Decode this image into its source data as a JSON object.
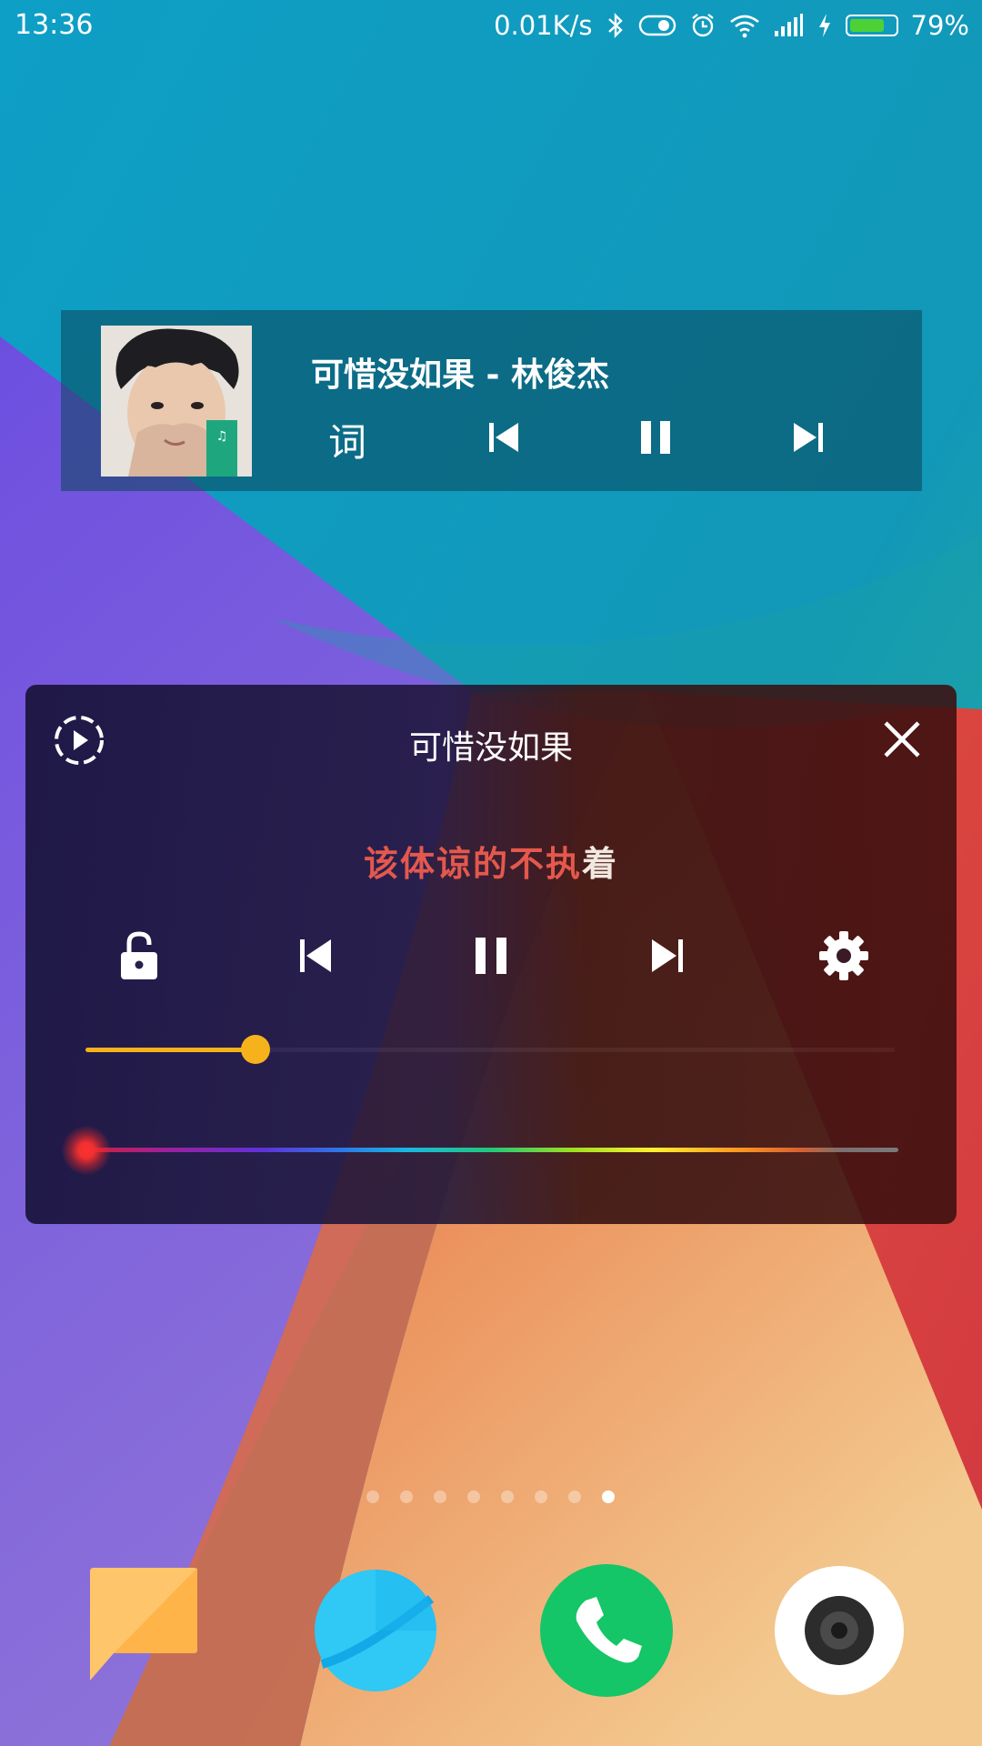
{
  "status_bar": {
    "time": "13:36",
    "network_speed": "0.01K/s",
    "battery_percent": "79%",
    "battery_level": 0.79,
    "icons": [
      "bluetooth-icon",
      "toggle-icon",
      "alarm-icon",
      "wifi-icon",
      "signal-icon",
      "charging-icon",
      "battery-icon"
    ]
  },
  "music_widget": {
    "title": "可惜没如果 - 林俊杰",
    "lyrics_button": "词",
    "controls": [
      "previous-icon",
      "pause-icon",
      "next-icon"
    ]
  },
  "lyric_panel": {
    "title": "可惜没如果",
    "lyric_sung": "该体谅的不执",
    "lyric_unsung": "着",
    "controls": [
      "lock-icon",
      "previous-icon",
      "pause-icon",
      "next-icon",
      "settings-icon"
    ],
    "seek_progress": 0.21,
    "color_picker_position": 0.0,
    "accent_color": "#f6b21b",
    "lyric_highlight_color": "#e4584d"
  },
  "home": {
    "page_count": 8,
    "active_page": 8
  },
  "dock": {
    "apps": [
      "messages-icon",
      "browser-icon",
      "phone-icon",
      "camera-icon"
    ]
  }
}
